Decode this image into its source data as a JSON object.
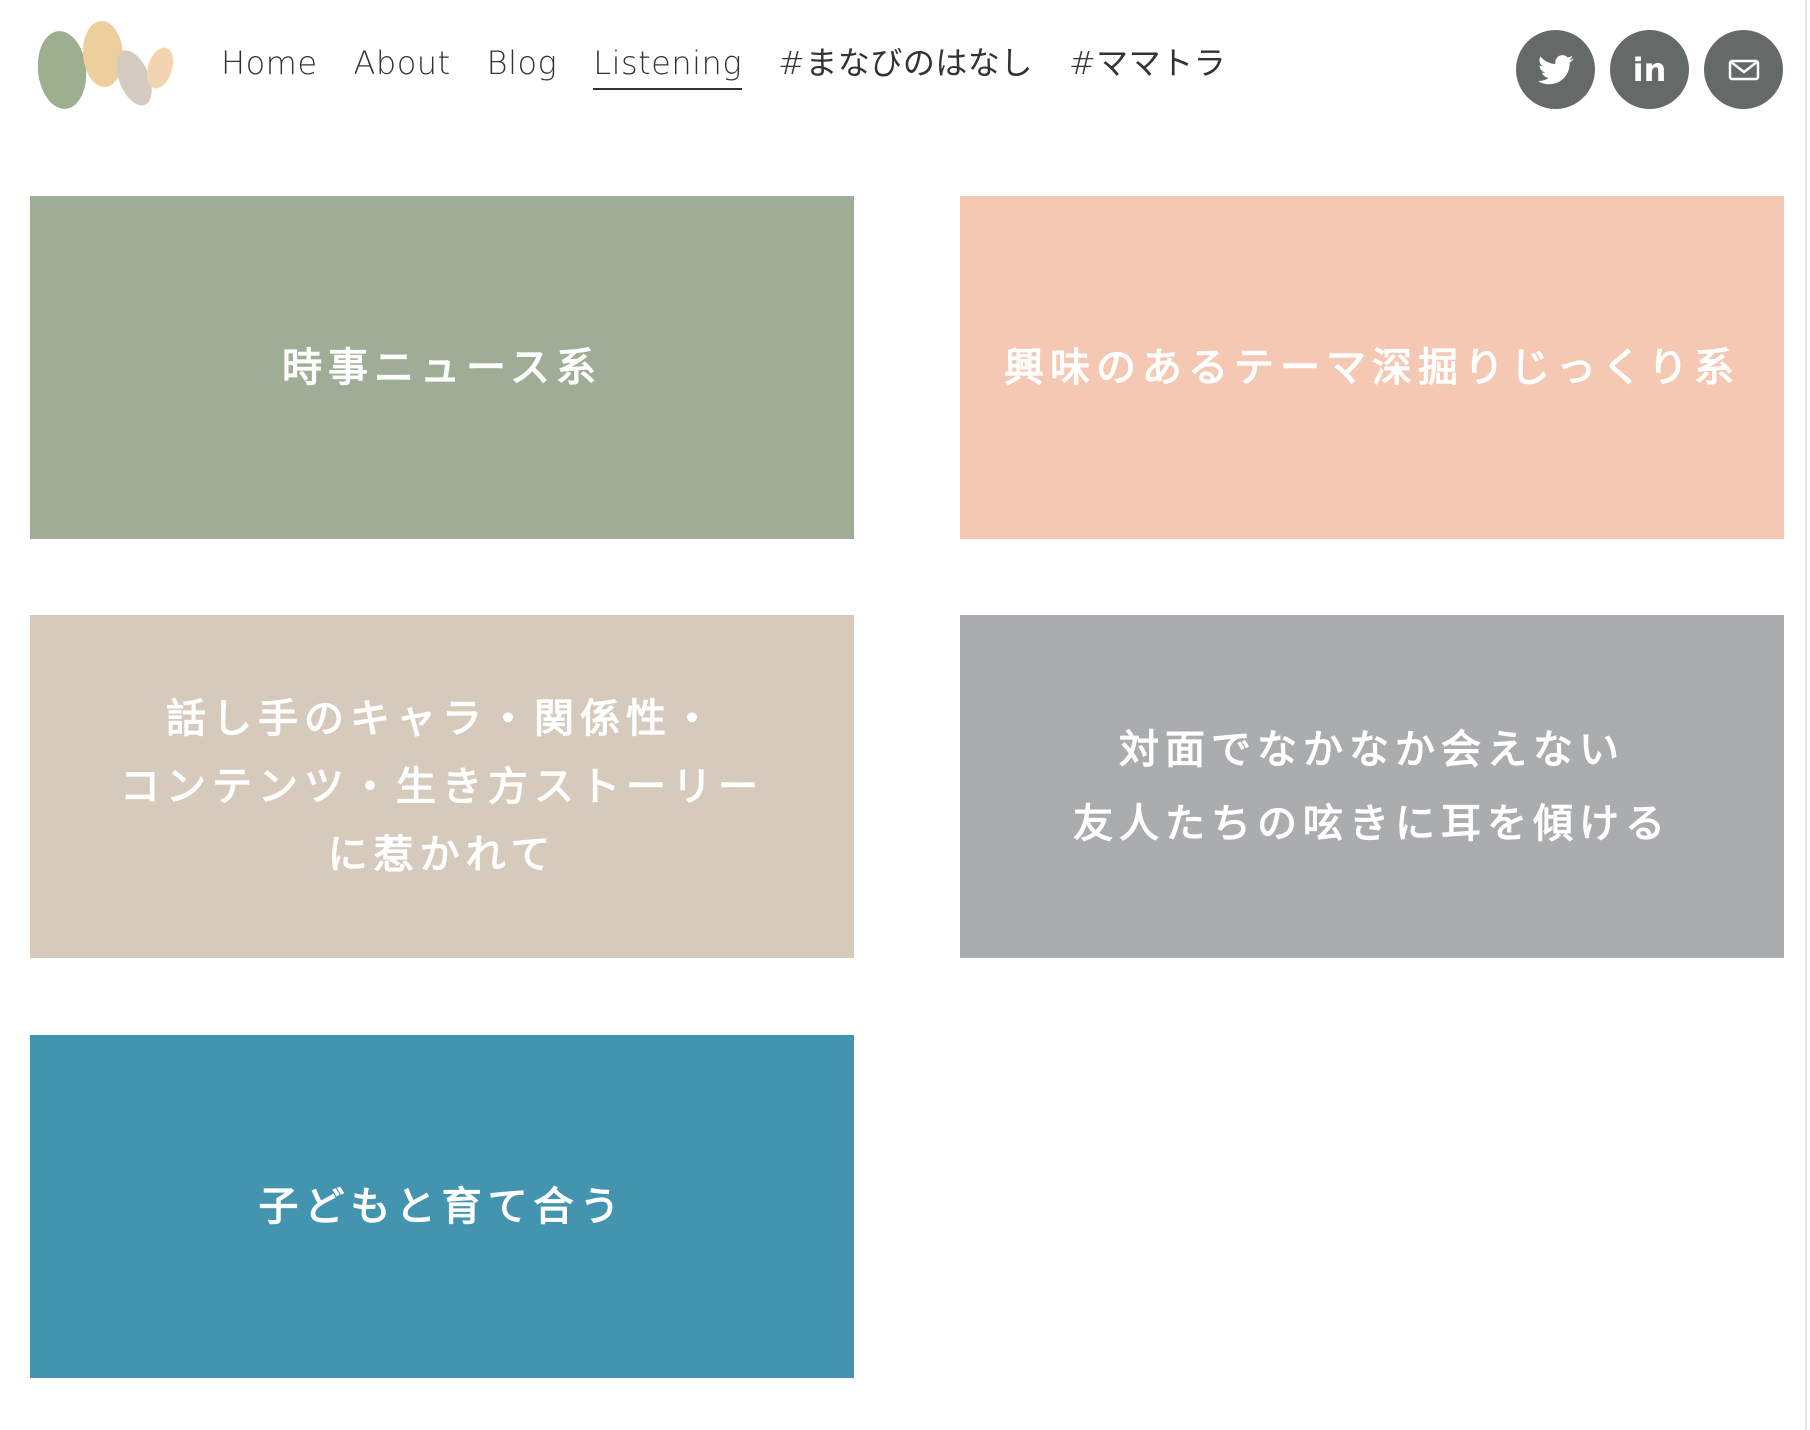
{
  "header": {
    "logo": {
      "icon": "pebbles-logo",
      "colors": [
        "#9eaf8f",
        "#edcf9e",
        "#d5cac0",
        "#f3d4b1"
      ]
    },
    "nav": [
      {
        "label": "Home",
        "active": false
      },
      {
        "label": "About",
        "active": false
      },
      {
        "label": "Blog",
        "active": false
      },
      {
        "label": "Listening",
        "active": true
      },
      {
        "label": "#まなびのはなし",
        "active": false
      },
      {
        "label": "#ママトラ",
        "active": false
      }
    ],
    "social": [
      {
        "icon": "twitter-icon"
      },
      {
        "icon": "linkedin-icon",
        "text": "in"
      },
      {
        "icon": "mail-icon"
      }
    ],
    "social_color": "#656a69"
  },
  "tiles": [
    {
      "label": "時事ニュース系",
      "color": "#a0ad96"
    },
    {
      "label": "興味のあるテーマ深掘りじっくり系",
      "color": "#f4c8b3"
    },
    {
      "label": "話し手のキャラ・関係性・\nコンテンツ・生き方ストーリー\nに惹かれて",
      "color": "#d6cabc"
    },
    {
      "label": "対面でなかなか会えない\n友人たちの呟きに耳を傾ける",
      "color": "#abacae"
    },
    {
      "label": "子どもと育て合う",
      "color": "#4294af"
    }
  ]
}
